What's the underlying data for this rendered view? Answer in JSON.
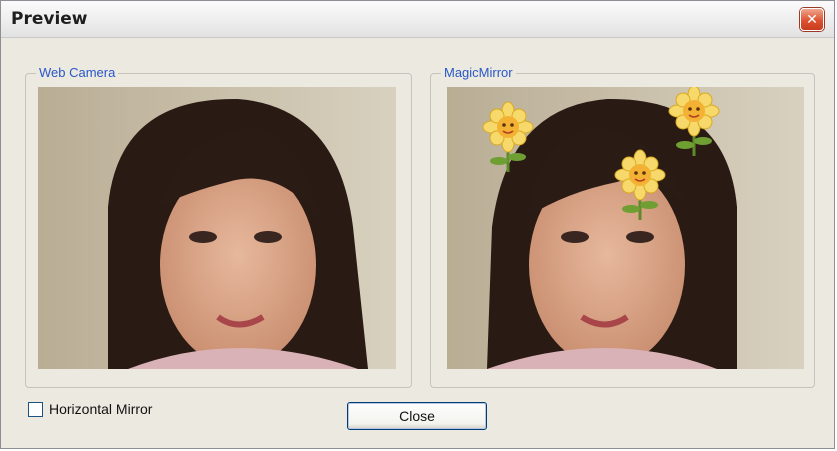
{
  "window": {
    "title": "Preview"
  },
  "panels": {
    "left": {
      "label": "Web Camera"
    },
    "right": {
      "label": "MagicMirror"
    }
  },
  "controls": {
    "mirror_label": "Horizontal Mirror",
    "mirror_checked": false,
    "close_label": "Close"
  },
  "icons": {
    "close": "close-icon",
    "flower": "sunflower-sticker-icon"
  },
  "colors": {
    "legend_text": "#2857c8",
    "close_accent": "#dd5231",
    "dialog_bg": "#ece9e0"
  }
}
